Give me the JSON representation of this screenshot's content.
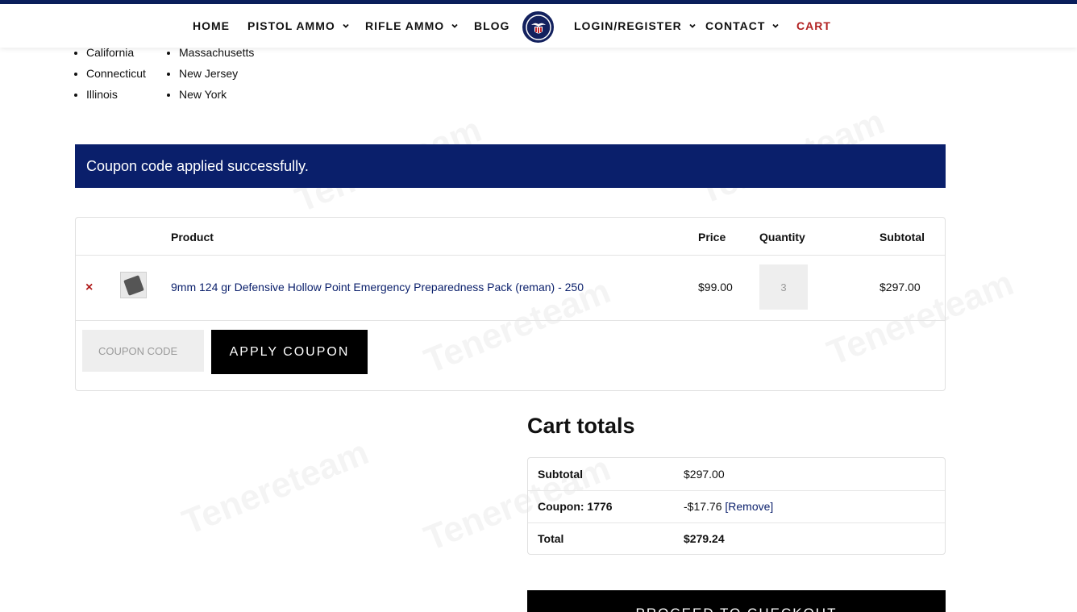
{
  "nav": {
    "items": [
      {
        "label": "HOME",
        "has_dropdown": false
      },
      {
        "label": "PISTOL AMMO",
        "has_dropdown": true
      },
      {
        "label": "RIFLE AMMO",
        "has_dropdown": true
      },
      {
        "label": "BLOG",
        "has_dropdown": false
      },
      {
        "label": "LOGIN/REGISTER",
        "has_dropdown": true
      },
      {
        "label": "CONTACT",
        "has_dropdown": true
      },
      {
        "label": "CART",
        "has_dropdown": false
      }
    ],
    "logo_icon": "eagle-shield-logo"
  },
  "restricted_states": {
    "col1": [
      "California",
      "Connecticut",
      "Illinois"
    ],
    "col2": [
      "Massachusetts",
      "New Jersey",
      "New York"
    ]
  },
  "notice": {
    "message": "Coupon code applied successfully."
  },
  "cart": {
    "headers": {
      "product": "Product",
      "price": "Price",
      "quantity": "Quantity",
      "subtotal": "Subtotal"
    },
    "items": [
      {
        "remove_icon": "×",
        "name": "9mm 124 gr Defensive Hollow Point Emergency Preparedness Pack (reman) - 250",
        "price": "$99.00",
        "quantity": "3",
        "subtotal": "$297.00"
      }
    ],
    "coupon_placeholder": "COUPON CODE",
    "apply_label": "APPLY COUPON"
  },
  "totals": {
    "title": "Cart totals",
    "subtotal_label": "Subtotal",
    "subtotal_value": "$297.00",
    "coupon_label": "Coupon: 1776",
    "coupon_value": "-$17.76",
    "coupon_remove": "[Remove]",
    "total_label": "Total",
    "total_value": "$279.24",
    "checkout_label": "PROCEED TO CHECKOUT"
  },
  "watermark": "Tenereteam",
  "colors": {
    "brand_navy": "#0a1f6b",
    "cart_red": "#b22222",
    "remove_red": "#b01a1a"
  }
}
